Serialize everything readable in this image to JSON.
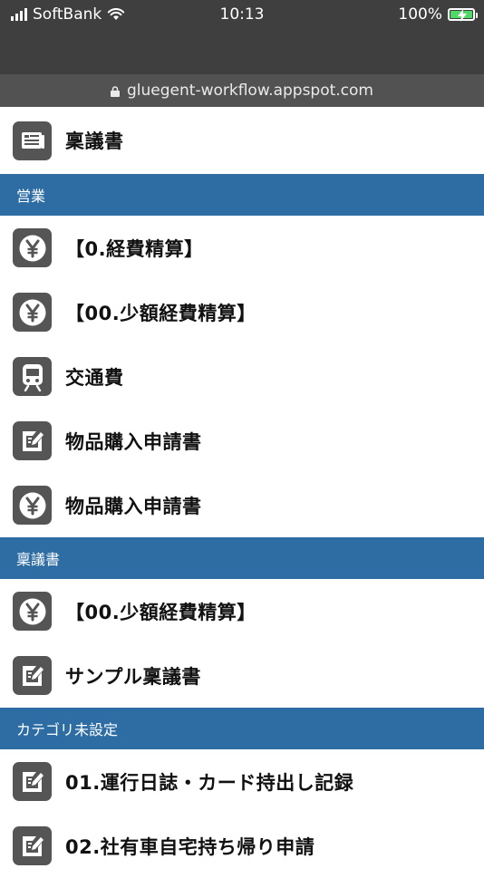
{
  "status": {
    "carrier": "SoftBank",
    "time": "10:13",
    "battery": "100%"
  },
  "url": "gluegent-workflow.appspot.com",
  "list": [
    {
      "kind": "item",
      "icon": "document-list-icon",
      "label": "稟議書"
    },
    {
      "kind": "section",
      "label": "営業"
    },
    {
      "kind": "item",
      "icon": "yen-icon",
      "label": "【0.経費精算】"
    },
    {
      "kind": "item",
      "icon": "yen-icon",
      "label": "【00.少額経費精算】"
    },
    {
      "kind": "item",
      "icon": "train-icon",
      "label": "交通費"
    },
    {
      "kind": "item",
      "icon": "edit-form-icon",
      "label": "物品購入申請書"
    },
    {
      "kind": "item",
      "icon": "yen-icon",
      "label": "物品購入申請書"
    },
    {
      "kind": "section",
      "label": "稟議書"
    },
    {
      "kind": "item",
      "icon": "yen-icon",
      "label": "【00.少額経費精算】"
    },
    {
      "kind": "item",
      "icon": "edit-form-icon",
      "label": "サンプル稟議書"
    },
    {
      "kind": "section",
      "label": "カテゴリ未設定"
    },
    {
      "kind": "item",
      "icon": "edit-form-icon",
      "label": "01.運行日誌・カード持出し記録"
    },
    {
      "kind": "item",
      "icon": "edit-form-icon",
      "label": "02.社有車自宅持ち帰り申請"
    }
  ]
}
